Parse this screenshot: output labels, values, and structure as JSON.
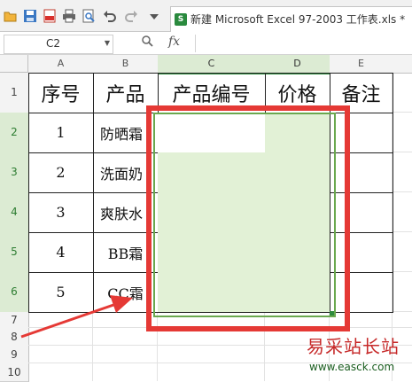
{
  "toolbar": {
    "icons": [
      "open-folder-icon",
      "save-icon",
      "export-pdf-icon",
      "print-icon",
      "print-preview-icon",
      "undo-icon",
      "redo-icon",
      "customize-dropdown-icon"
    ],
    "document_tab_title": "新建 Microsoft Excel 97-2003 工作表.xls *"
  },
  "formula_bar": {
    "name_box": "C2",
    "fx_label": "fx",
    "formula": ""
  },
  "columns": [
    "A",
    "B",
    "C",
    "D",
    "E"
  ],
  "rows": [
    "1",
    "2",
    "3",
    "4",
    "5",
    "6",
    "7",
    "8",
    "9",
    "10"
  ],
  "table": {
    "headers": [
      "序号",
      "产品",
      "产品编号",
      "价格",
      "备注"
    ],
    "rows": [
      [
        "1",
        "防晒霜",
        "",
        "",
        ""
      ],
      [
        "2",
        "洗面奶",
        "",
        "",
        ""
      ],
      [
        "3",
        "爽肤水",
        "",
        "",
        ""
      ],
      [
        "4",
        "BB霜",
        "",
        "",
        ""
      ],
      [
        "5",
        "CC霜",
        "",
        "",
        ""
      ]
    ]
  },
  "selection": {
    "range": "C2:D6",
    "fill_color": "#e2f1d6",
    "border_color": "#6aa84f"
  },
  "annotation": {
    "highlight_color": "#e53935"
  },
  "watermark": {
    "text": "易采站长站",
    "url": "www.easck.com"
  }
}
